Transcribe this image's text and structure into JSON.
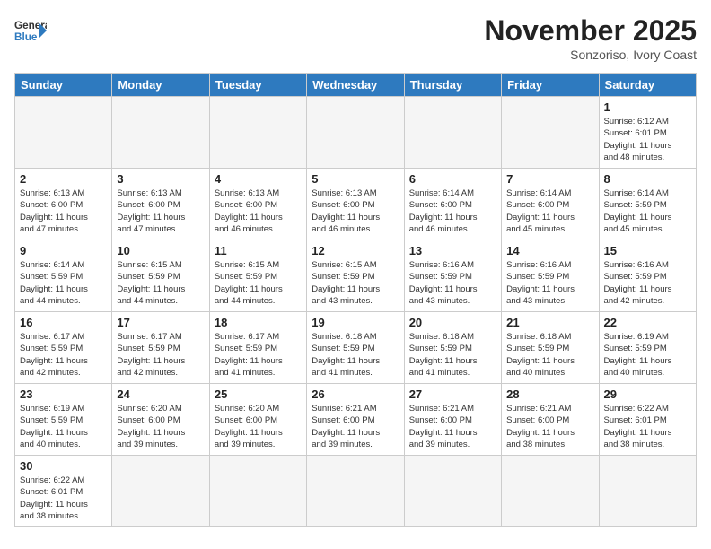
{
  "logo": {
    "general": "General",
    "blue": "Blue"
  },
  "title": "November 2025",
  "subtitle": "Sonzoriso, Ivory Coast",
  "days_of_week": [
    "Sunday",
    "Monday",
    "Tuesday",
    "Wednesday",
    "Thursday",
    "Friday",
    "Saturday"
  ],
  "weeks": [
    [
      {
        "day": "",
        "info": ""
      },
      {
        "day": "",
        "info": ""
      },
      {
        "day": "",
        "info": ""
      },
      {
        "day": "",
        "info": ""
      },
      {
        "day": "",
        "info": ""
      },
      {
        "day": "",
        "info": ""
      },
      {
        "day": "1",
        "info": "Sunrise: 6:12 AM\nSunset: 6:01 PM\nDaylight: 11 hours\nand 48 minutes."
      }
    ],
    [
      {
        "day": "2",
        "info": "Sunrise: 6:13 AM\nSunset: 6:00 PM\nDaylight: 11 hours\nand 47 minutes."
      },
      {
        "day": "3",
        "info": "Sunrise: 6:13 AM\nSunset: 6:00 PM\nDaylight: 11 hours\nand 47 minutes."
      },
      {
        "day": "4",
        "info": "Sunrise: 6:13 AM\nSunset: 6:00 PM\nDaylight: 11 hours\nand 46 minutes."
      },
      {
        "day": "5",
        "info": "Sunrise: 6:13 AM\nSunset: 6:00 PM\nDaylight: 11 hours\nand 46 minutes."
      },
      {
        "day": "6",
        "info": "Sunrise: 6:14 AM\nSunset: 6:00 PM\nDaylight: 11 hours\nand 46 minutes."
      },
      {
        "day": "7",
        "info": "Sunrise: 6:14 AM\nSunset: 6:00 PM\nDaylight: 11 hours\nand 45 minutes."
      },
      {
        "day": "8",
        "info": "Sunrise: 6:14 AM\nSunset: 5:59 PM\nDaylight: 11 hours\nand 45 minutes."
      }
    ],
    [
      {
        "day": "9",
        "info": "Sunrise: 6:14 AM\nSunset: 5:59 PM\nDaylight: 11 hours\nand 44 minutes."
      },
      {
        "day": "10",
        "info": "Sunrise: 6:15 AM\nSunset: 5:59 PM\nDaylight: 11 hours\nand 44 minutes."
      },
      {
        "day": "11",
        "info": "Sunrise: 6:15 AM\nSunset: 5:59 PM\nDaylight: 11 hours\nand 44 minutes."
      },
      {
        "day": "12",
        "info": "Sunrise: 6:15 AM\nSunset: 5:59 PM\nDaylight: 11 hours\nand 43 minutes."
      },
      {
        "day": "13",
        "info": "Sunrise: 6:16 AM\nSunset: 5:59 PM\nDaylight: 11 hours\nand 43 minutes."
      },
      {
        "day": "14",
        "info": "Sunrise: 6:16 AM\nSunset: 5:59 PM\nDaylight: 11 hours\nand 43 minutes."
      },
      {
        "day": "15",
        "info": "Sunrise: 6:16 AM\nSunset: 5:59 PM\nDaylight: 11 hours\nand 42 minutes."
      }
    ],
    [
      {
        "day": "16",
        "info": "Sunrise: 6:17 AM\nSunset: 5:59 PM\nDaylight: 11 hours\nand 42 minutes."
      },
      {
        "day": "17",
        "info": "Sunrise: 6:17 AM\nSunset: 5:59 PM\nDaylight: 11 hours\nand 42 minutes."
      },
      {
        "day": "18",
        "info": "Sunrise: 6:17 AM\nSunset: 5:59 PM\nDaylight: 11 hours\nand 41 minutes."
      },
      {
        "day": "19",
        "info": "Sunrise: 6:18 AM\nSunset: 5:59 PM\nDaylight: 11 hours\nand 41 minutes."
      },
      {
        "day": "20",
        "info": "Sunrise: 6:18 AM\nSunset: 5:59 PM\nDaylight: 11 hours\nand 41 minutes."
      },
      {
        "day": "21",
        "info": "Sunrise: 6:18 AM\nSunset: 5:59 PM\nDaylight: 11 hours\nand 40 minutes."
      },
      {
        "day": "22",
        "info": "Sunrise: 6:19 AM\nSunset: 5:59 PM\nDaylight: 11 hours\nand 40 minutes."
      }
    ],
    [
      {
        "day": "23",
        "info": "Sunrise: 6:19 AM\nSunset: 5:59 PM\nDaylight: 11 hours\nand 40 minutes."
      },
      {
        "day": "24",
        "info": "Sunrise: 6:20 AM\nSunset: 6:00 PM\nDaylight: 11 hours\nand 39 minutes."
      },
      {
        "day": "25",
        "info": "Sunrise: 6:20 AM\nSunset: 6:00 PM\nDaylight: 11 hours\nand 39 minutes."
      },
      {
        "day": "26",
        "info": "Sunrise: 6:21 AM\nSunset: 6:00 PM\nDaylight: 11 hours\nand 39 minutes."
      },
      {
        "day": "27",
        "info": "Sunrise: 6:21 AM\nSunset: 6:00 PM\nDaylight: 11 hours\nand 39 minutes."
      },
      {
        "day": "28",
        "info": "Sunrise: 6:21 AM\nSunset: 6:00 PM\nDaylight: 11 hours\nand 38 minutes."
      },
      {
        "day": "29",
        "info": "Sunrise: 6:22 AM\nSunset: 6:01 PM\nDaylight: 11 hours\nand 38 minutes."
      }
    ],
    [
      {
        "day": "30",
        "info": "Sunrise: 6:22 AM\nSunset: 6:01 PM\nDaylight: 11 hours\nand 38 minutes."
      },
      {
        "day": "",
        "info": ""
      },
      {
        "day": "",
        "info": ""
      },
      {
        "day": "",
        "info": ""
      },
      {
        "day": "",
        "info": ""
      },
      {
        "day": "",
        "info": ""
      },
      {
        "day": "",
        "info": ""
      }
    ]
  ]
}
